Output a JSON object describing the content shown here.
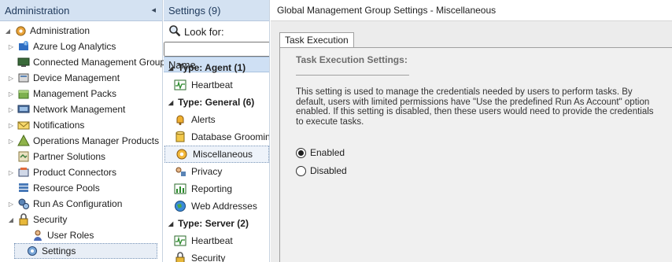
{
  "nav": {
    "header": "Administration",
    "collapse_glyph": "◂",
    "root": {
      "label": "Administration",
      "icon": "gear-icon"
    },
    "items": [
      {
        "label": "Azure Log Analytics",
        "icon": "azure-icon",
        "expandable": true
      },
      {
        "label": "Connected Management Groups",
        "icon": "monitor-icon",
        "expandable": false
      },
      {
        "label": "Device Management",
        "icon": "device-icon",
        "expandable": true
      },
      {
        "label": "Management Packs",
        "icon": "package-icon",
        "expandable": true
      },
      {
        "label": "Network Management",
        "icon": "network-icon",
        "expandable": true
      },
      {
        "label": "Notifications",
        "icon": "envelope-icon",
        "expandable": true
      },
      {
        "label": "Operations Manager Products",
        "icon": "product-icon",
        "expandable": true
      },
      {
        "label": "Partner Solutions",
        "icon": "partner-icon",
        "expandable": false
      },
      {
        "label": "Product Connectors",
        "icon": "connector-icon",
        "expandable": true
      },
      {
        "label": "Resource Pools",
        "icon": "pool-icon",
        "expandable": false
      },
      {
        "label": "Run As Configuration",
        "icon": "gears-icon",
        "expandable": true
      },
      {
        "label": "Security",
        "icon": "lock-icon",
        "expandable": true,
        "expanded": true
      },
      {
        "label": "User Roles",
        "icon": "user-icon",
        "child": true
      },
      {
        "label": "Settings",
        "icon": "settings-icon",
        "selected": true
      }
    ]
  },
  "list": {
    "header": "Settings (9)",
    "look_for_label": "Look for:",
    "column_name": "Name",
    "groups": [
      {
        "label": "Type: Agent (1)",
        "items": [
          {
            "label": "Heartbeat",
            "icon": "heartbeat-icon"
          }
        ]
      },
      {
        "label": "Type: General (6)",
        "items": [
          {
            "label": "Alerts",
            "icon": "bell-icon"
          },
          {
            "label": "Database Grooming",
            "icon": "database-icon"
          },
          {
            "label": "Miscellaneous",
            "icon": "gear-icon",
            "selected": true
          },
          {
            "label": "Privacy",
            "icon": "privacy-icon"
          },
          {
            "label": "Reporting",
            "icon": "reporting-icon"
          },
          {
            "label": "Web Addresses",
            "icon": "globe-icon"
          }
        ]
      },
      {
        "label": "Type: Server (2)",
        "items": [
          {
            "label": "Heartbeat",
            "icon": "heartbeat-icon"
          },
          {
            "label": "Security",
            "icon": "security-icon"
          }
        ]
      }
    ]
  },
  "detail": {
    "title": "Global Management Group Settings - Miscellaneous",
    "tab": "Task Execution",
    "section_title": "Task Execution Settings:",
    "description": "This setting is used to manage the credentials needed by users to perform tasks. By default, users with limited permissions have \"Use the predefined Run As Account\" option enabled. If this setting is disabled, then these users would need to provide the credentials to execute tasks.",
    "options": [
      {
        "label": "Enabled",
        "checked": true
      },
      {
        "label": "Disabled",
        "checked": false
      }
    ]
  }
}
